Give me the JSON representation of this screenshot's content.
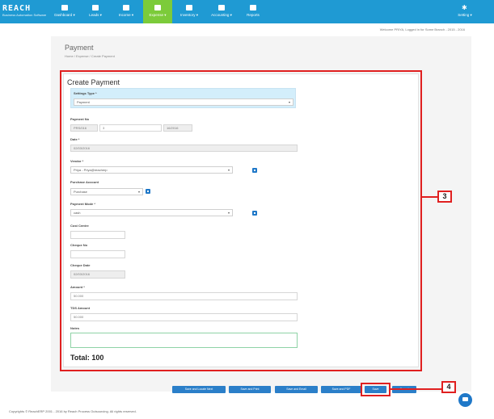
{
  "brand": {
    "logo": "REACH",
    "tagline": "Business Automation Software"
  },
  "nav": [
    {
      "label": "Dashboard ▾",
      "icon": "dashboard-icon"
    },
    {
      "label": "Leads ▾",
      "icon": "leads-icon"
    },
    {
      "label": "Income ▾",
      "icon": "income-icon"
    },
    {
      "label": "Expense ▾",
      "icon": "expense-icon"
    },
    {
      "label": "Inventory ▾",
      "icon": "inventory-icon"
    },
    {
      "label": "Accounting ▾",
      "icon": "accounting-icon"
    },
    {
      "label": "Reports",
      "icon": "reports-icon"
    }
  ],
  "settings_menu": {
    "label": "Setting ▾",
    "icon": "gear-icon"
  },
  "welcome": "Welcome PRIYA, Logged in for Some Branch - 2015 - 2016",
  "page": {
    "title": "Payment",
    "breadcrumb": "Home / Expense / Create Payment"
  },
  "form": {
    "title": "Create Payment",
    "settings_type": {
      "label": "Settings Type *",
      "value": "Payment"
    },
    "payment_no": {
      "label": "Payment No",
      "prefix": "PRS/016",
      "number": "3",
      "suffix": "16/2016"
    },
    "date": {
      "label": "Date *",
      "value": "02/03/2016"
    },
    "vendor": {
      "label": "Vendor *",
      "value": "Priya - Priya@reacherp"
    },
    "purchase_account": {
      "label": "Purchase Account",
      "value": "Purchase"
    },
    "payment_mode": {
      "label": "Payment Mode *",
      "value": "cash"
    },
    "cost_centre": {
      "label": "Cost Centre",
      "value": ""
    },
    "cheque_no": {
      "label": "Cheque No",
      "value": ""
    },
    "cheque_date": {
      "label": "Cheque Date",
      "value": "02/03/2016"
    },
    "amount": {
      "label": "Amount *",
      "value": "50.000"
    },
    "tds_amount": {
      "label": "TDS Amount",
      "value": "50.000"
    },
    "notes": {
      "label": "Notes",
      "value": ""
    },
    "total": "Total: 100"
  },
  "buttons": [
    "Save and Locate Next",
    "Save and Print",
    "Save and Email",
    "Save and PDF",
    "Save",
    "Cancel"
  ],
  "callouts": {
    "panel": "3",
    "save": "4"
  },
  "footer": "Copyrights © ReachERP 2001 - 2016 by Reach Process Outsourcing. All rights reserved."
}
